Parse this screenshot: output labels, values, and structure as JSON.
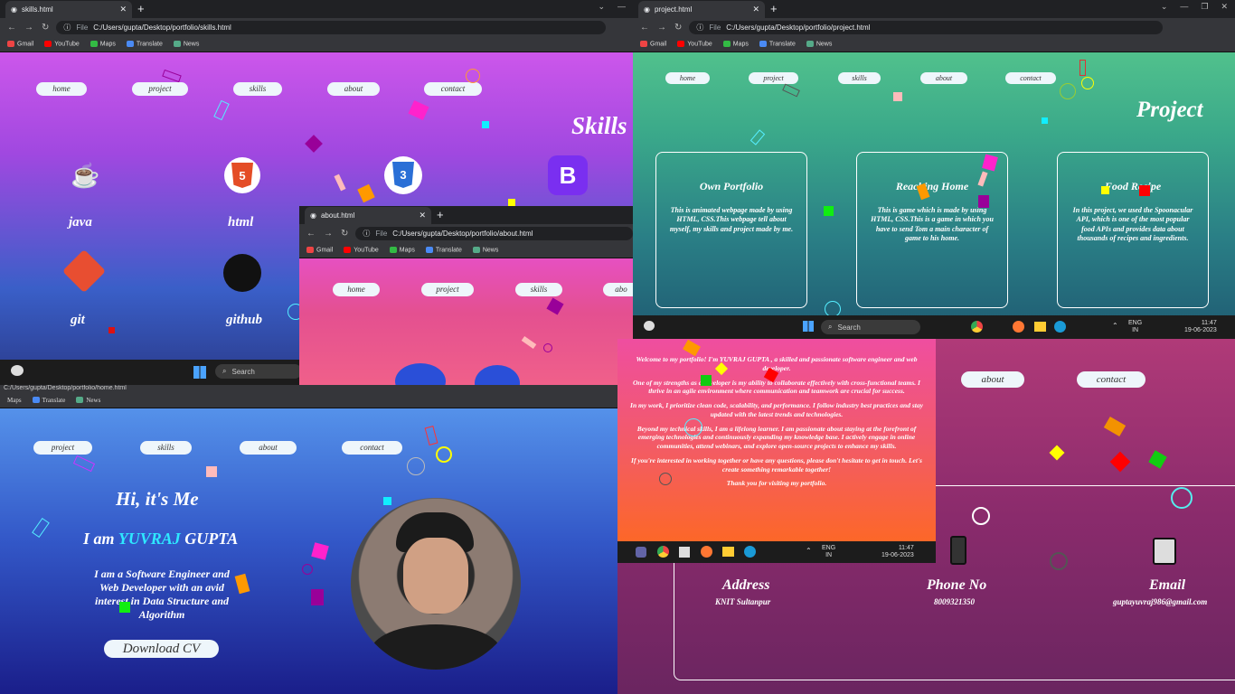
{
  "browser": {
    "gmail": "Gmail",
    "youtube": "YouTube",
    "maps": "Maps",
    "translate": "Translate",
    "news": "News",
    "file": "File"
  },
  "skills_window": {
    "tab_title": "skills.html",
    "url": "C:/Users/gupta/Desktop/portfolio/skills.html",
    "nav": [
      "home",
      "project",
      "skills",
      "about",
      "contact"
    ],
    "heading": "Skills",
    "skills": [
      "java",
      "html",
      "git",
      "github"
    ]
  },
  "project_window": {
    "tab_title": "project.html",
    "url": "C:/Users/gupta/Desktop/portfolio/project.html",
    "nav": [
      "home",
      "project",
      "skills",
      "about",
      "contact"
    ],
    "heading": "Project",
    "cards": [
      {
        "title": "Own Portfolio",
        "text": "This is animated webpage made by using HTML, CSS.This webpage tell about myself, my skills and project made by me."
      },
      {
        "title": "Reaching Home",
        "text": "This is game which is made by using HTML, CSS.This is a game in which you have to send Tom a main character of game to his home."
      },
      {
        "title": "Food Recipe",
        "text": "In this project, we used the Spoonacular API, which is one of the most popular food APIs and provides data about thousands of recipes and ingredients."
      }
    ]
  },
  "about_window": {
    "tab_title": "about.html",
    "url": "C:/Users/gupta/Desktop/portfolio/about.html",
    "nav": [
      "home",
      "project",
      "skills",
      "abo"
    ],
    "paragraphs": [
      "Welcome to my portfolio! I'm YUVRAJ GUPTA , a skilled and passionate software engineer and web developer.",
      "One of my strengths as a developer is my ability to collaborate effectively with cross-functional teams. I thrive in an agile environment where communication and teamwork are crucial for success.",
      "In my work, I prioritize clean code, scalability, and performance. I follow industry best practices and stay updated with the latest trends and technologies.",
      "Beyond my technical skills, I am a lifelong learner. I am passionate about staying at the forefront of emerging technologies and continuously expanding my knowledge base. I actively engage in online communities, attend webinars, and explore open-source projects to enhance my skills.",
      "If you're interested in working together or have any questions, please don't hesitate to get in touch. Let's create something remarkable together!",
      "Thank you for visiting my portfolio."
    ]
  },
  "home_window": {
    "path_fragment": "C:/Users/gupta/Desktop/portfolio/home.html",
    "nav": [
      "project",
      "skills",
      "about",
      "contact"
    ],
    "greeting": "Hi, it's Me",
    "name_prefix": "I am",
    "name_highlight": "YUVRAJ",
    "name_suffix": "GUPTA",
    "bio": "I am a Software Engineer and Web Developer with an avid interest in Data Structure and Algorithm",
    "cv_button": "Download CV"
  },
  "contact_window": {
    "nav": [
      "about",
      "contact"
    ],
    "items": [
      {
        "label": "Address",
        "value": "KNIT Sultanpur"
      },
      {
        "label": "Phone No",
        "value": "8009321350"
      },
      {
        "label": "Email",
        "value": "guptayuvraj986@gmail.com"
      }
    ]
  },
  "taskbar": {
    "search": "Search",
    "lang_top": "ENG",
    "lang_bottom": "IN",
    "time": "11:47",
    "date": "19-06-2023"
  }
}
